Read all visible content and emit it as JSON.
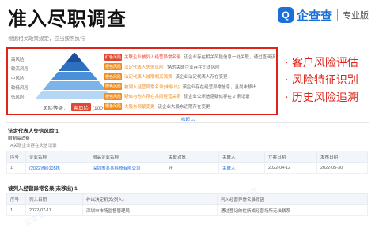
{
  "header": {
    "title": "准入尽职调查",
    "brand_logo_char": "Q",
    "brand_name": "企查查",
    "brand_tag": "专业版"
  },
  "subtitle": "根据相关政策规定，应当按照执行",
  "pyramid": {
    "levels": [
      "高风险",
      "较高风险",
      "中风险",
      "较低风险",
      "低风险"
    ],
    "colors": [
      "#1f4e9c",
      "#2f6fc0",
      "#4a90d9",
      "#7ab4ea",
      "#b5d6f4"
    ]
  },
  "risk_grade": {
    "label": "风险等级：",
    "value": "高风险",
    "score": "(100分)"
  },
  "risk_items": [
    {
      "tag": "红色风险",
      "level": "red",
      "title": "关联企业被列入经营异常名录",
      "desc": "该企业存在相关风险信息一处关联，通过查阅该企业关联"
    },
    {
      "tag": "橙色风险",
      "level": "orange",
      "title": "法定代表人失信风险",
      "desc": "TA的关联企业存在司法风险"
    },
    {
      "tag": "橙色风险",
      "level": "orange",
      "title": "法定代表人被限制高消费",
      "desc": "该企业法定代表人存在变更"
    },
    {
      "tag": "橙色风险",
      "level": "orange",
      "title": "被列入经营异常名录(未移出)",
      "desc": "该企业存在经营异常信息，且尚未移出"
    },
    {
      "tag": "橙色风险",
      "level": "orange",
      "title": "疑似与他人存在共同经营关系",
      "desc": "该企业公示信息疑似存在 2 条记录"
    },
    {
      "tag": "橙色风险",
      "level": "orange",
      "title": "大股东频繁变更",
      "desc": "该企业大股东近期存在变更"
    }
  ],
  "annotations": [
    "· 客户风险评估",
    "· 风险特征识别",
    "· 历史风险追溯"
  ],
  "collapse_label": "收起 ︿",
  "section1": {
    "title": "法定代表人失信风险 1",
    "sub": "限制高消费",
    "note": "TA关联企业存在失信记录",
    "headers": [
      "序号",
      "企业名称",
      "限高企业名称",
      "关联对象",
      "关联人",
      "立案日期",
      "发布日期"
    ],
    "rows": [
      {
        "no": "1",
        "company": "(2022)豫0105执",
        "target": "深圳市某某科技有限公司",
        "relation": "叶",
        "person": "关联人",
        "case_date": "2022-04-12",
        "pub_date": "2022-05-30"
      }
    ]
  },
  "section2": {
    "title": "被列入经营异常名录(未移出) 1",
    "headers": [
      "序号",
      "列入日期",
      "作出决定机关(列入)",
      "列入经营异常名录原因"
    ],
    "rows": [
      {
        "no": "1",
        "date": "2022-07-11",
        "authority": "深圳市市场监督管理局",
        "reason": "通过登记的住所或经营场所无法联系"
      }
    ]
  }
}
